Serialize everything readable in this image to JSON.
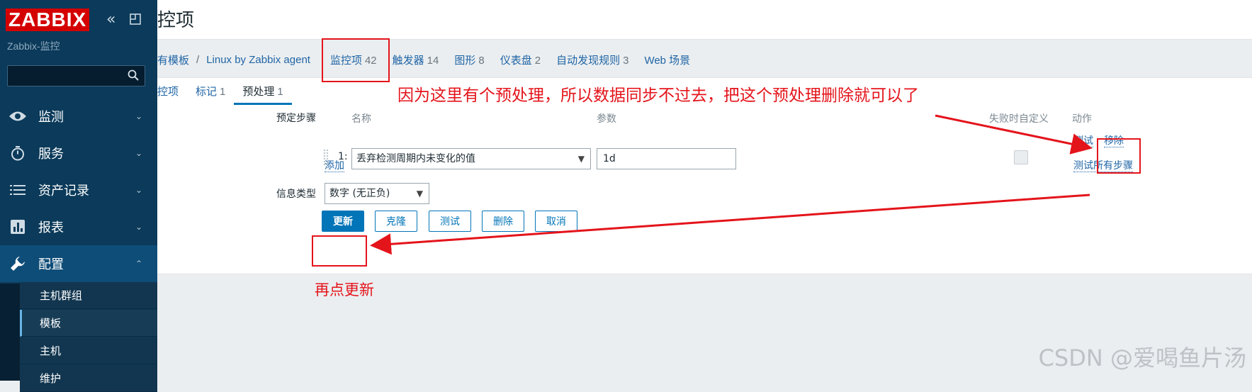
{
  "sidebar": {
    "logo": "ZABBIX",
    "collapse_glyph": "«",
    "server_name": "Zabbix-监控",
    "search_value": "",
    "menu": [
      {
        "label": "监测",
        "chevron": "⌄"
      },
      {
        "label": "服务",
        "chevron": "⌄"
      },
      {
        "label": "资产记录",
        "chevron": "⌄"
      },
      {
        "label": "报表",
        "chevron": "⌄"
      },
      {
        "label": "配置",
        "chevron": "⌃"
      }
    ],
    "submenu": [
      {
        "label": "主机群组"
      },
      {
        "label": "模板"
      },
      {
        "label": "主机"
      },
      {
        "label": "维护"
      }
    ]
  },
  "header": {
    "title": "控项"
  },
  "breadcrumb": {
    "items": [
      "有模板",
      "Linux by Zabbix agent"
    ],
    "separator": "/"
  },
  "nav_tabs": [
    {
      "label": "监控项",
      "count": "42"
    },
    {
      "label": "触发器",
      "count": "14"
    },
    {
      "label": "图形",
      "count": "8"
    },
    {
      "label": "仪表盘",
      "count": "2"
    },
    {
      "label": "自动发现规则",
      "count": "3"
    },
    {
      "label": "Web 场景",
      "count": ""
    }
  ],
  "sub_tabs": [
    {
      "label": "控项",
      "count": ""
    },
    {
      "label": "标记",
      "count": "1"
    },
    {
      "label": "预处理",
      "count": "1"
    }
  ],
  "form": {
    "steps_label": "预定步骤",
    "col_name": "名称",
    "col_params": "参数",
    "col_custom_on_fail": "失败时自定义",
    "col_actions": "动作",
    "step": {
      "number": "1:",
      "name": "丢弃检测周期内未变化的值",
      "param": "1d",
      "test_link": "测试",
      "remove_link": "移除"
    },
    "add_link": "添加",
    "test_all_link": "测试所有步骤",
    "info_type_label": "信息类型",
    "info_type_value": "数字 (无正负)"
  },
  "buttons": {
    "update": "更新",
    "clone": "克隆",
    "test": "测试",
    "delete": "删除",
    "cancel": "取消"
  },
  "annotations": {
    "main_note": "因为这里有个预处理，所以数据同步不过去，把这个预处理删除就可以了",
    "update_note": "再点更新",
    "color": "#e4141b"
  },
  "watermark": "CSDN @爱喝鱼片汤"
}
